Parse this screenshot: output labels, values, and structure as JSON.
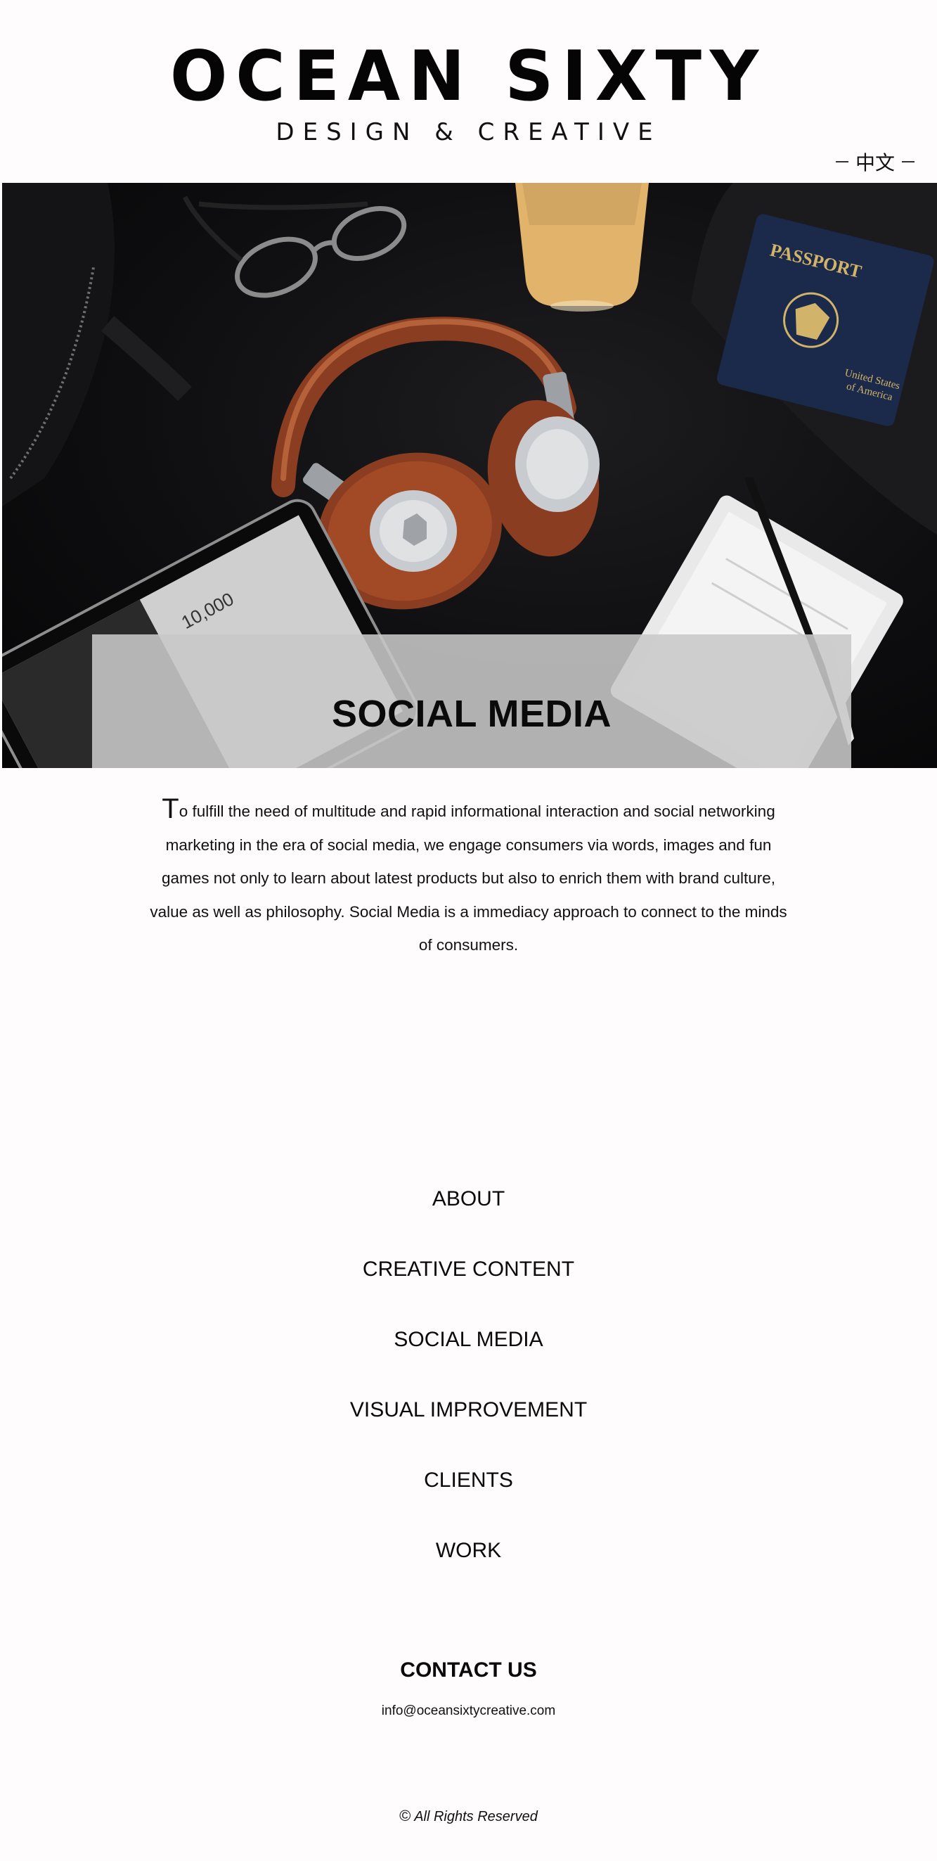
{
  "header": {
    "logo_title": "OCEAN SIXTY",
    "logo_subtitle": "DESIGN & CREATIVE",
    "language_label": "中文"
  },
  "hero": {
    "image_icon": "hero-photo",
    "caption": "SOCIAL MEDIA"
  },
  "intro": {
    "drop_cap": "T",
    "text": "o fulfill the need of multitude and rapid informational interaction and social networking marketing in the era of social media, we engage consumers via words, images and fun games not only to learn about latest products but also to enrich them with brand culture, value as well as philosophy. Social Media is a immediacy approach to connect to the minds of consumers."
  },
  "nav": {
    "items": [
      {
        "label": "ABOUT"
      },
      {
        "label": "CREATIVE CONTENT"
      },
      {
        "label": "SOCIAL MEDIA"
      },
      {
        "label": "VISUAL IMPROVEMENT"
      },
      {
        "label": "CLIENTS"
      },
      {
        "label": "WORK"
      }
    ]
  },
  "contact": {
    "title": "CONTACT US",
    "email": "info@oceansixtycreative.com"
  },
  "footer": {
    "copyright_symbol": "©",
    "copyright_text": "All Rights Reserved"
  },
  "colors": {
    "background": "#fefcfc",
    "hero_dark": "#0e0e10",
    "caption_box": "#c8c8c8",
    "headphone_leather": "#8a3d20",
    "passport_blue": "#1b2a4a"
  }
}
